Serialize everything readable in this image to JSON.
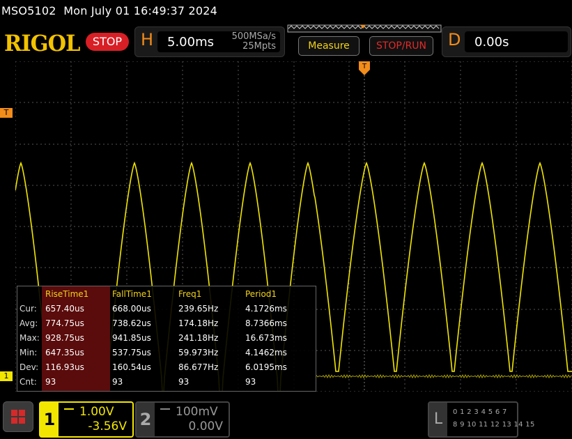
{
  "titlebar": {
    "model": "MSO5102",
    "datetime": "Mon July 01 16:49:37 2024"
  },
  "topbar": {
    "logo": "RIGOL",
    "run_state": "STOP",
    "horizontal": {
      "label": "H",
      "timebase": "5.00ms",
      "sample_rate": "500MSa/s",
      "memory_depth": "25Mpts"
    },
    "measure_label": "Measure",
    "stop_run_label": "STOP/RUN",
    "delay": {
      "label": "D",
      "value": "0.00s"
    }
  },
  "markers": {
    "trigger_level": "T",
    "channel1": "1",
    "trigger_position": "T"
  },
  "measurements": {
    "headers": [
      "RiseTime1",
      "FallTime1",
      "Freq1",
      "Period1"
    ],
    "rows": [
      {
        "label": "Cur:",
        "values": [
          "657.40us",
          "668.00us",
          "239.65Hz",
          "4.1726ms"
        ]
      },
      {
        "label": "Avg:",
        "values": [
          "774.75us",
          "738.62us",
          "174.18Hz",
          "8.7366ms"
        ]
      },
      {
        "label": "Max:",
        "values": [
          "928.75us",
          "941.85us",
          "241.18Hz",
          "16.673ms"
        ]
      },
      {
        "label": "Min:",
        "values": [
          "647.35us",
          "537.75us",
          "59.973Hz",
          "4.1462ms"
        ]
      },
      {
        "label": "Dev:",
        "values": [
          "116.93us",
          "160.54us",
          "86.677Hz",
          "6.0195ms"
        ]
      },
      {
        "label": "Cnt:",
        "values": [
          "93",
          "93",
          "93",
          "93"
        ]
      }
    ]
  },
  "channels": {
    "ch1": {
      "number": "1",
      "scale": "1.00V",
      "offset": "-3.56V"
    },
    "ch2": {
      "number": "2",
      "scale": "100mV",
      "offset": "0.00V"
    }
  },
  "logic_analyzer": {
    "label": "L",
    "row1": "0 1 2 3   4 5 6 7",
    "row2": "8 9 10 11 12 13 14 15"
  },
  "colors": {
    "ch1": "#f2e600",
    "accent": "#f28c1a",
    "stop": "#d81f25",
    "logo": "#f2c200"
  },
  "icons": {
    "menu": "grid-menu-icon",
    "coupling": "dc-coupling-icon",
    "trigger_strip": "trigger-position-strip-icon"
  }
}
